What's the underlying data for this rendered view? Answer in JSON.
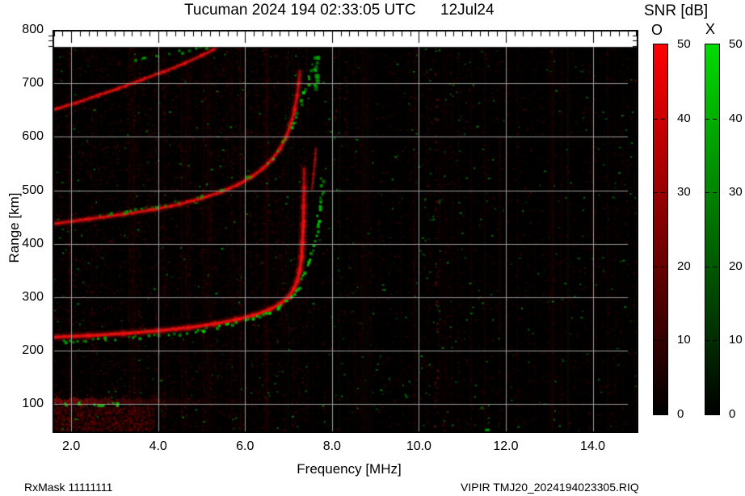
{
  "title": {
    "main": "Tucuman 2024 194 02:33:05 UTC",
    "date": "12Jul24"
  },
  "footer": {
    "left": "RxMask 11111111",
    "right": "VIPIR  TMJ20_2024194023305.RIQ"
  },
  "colorbar": {
    "title": "SNR [dB]",
    "o_label": "O",
    "x_label": "X",
    "min": 0,
    "max": 50,
    "ticks": [
      0,
      10,
      20,
      30,
      40,
      50
    ],
    "o_color_top": "#ff0000",
    "x_color_top": "#00dc00",
    "bottom_color": "#000000"
  },
  "chart_data": {
    "type": "heatmap",
    "title": "Tucuman 2024 194 02:33:05 UTC 12Jul24",
    "xlabel": "Frequency [MHz]",
    "ylabel": "Range [km]",
    "xlim": [
      1.57,
      15.05
    ],
    "ylim": [
      46,
      800
    ],
    "x_ticks": [
      2,
      4,
      6,
      8,
      10,
      12,
      14
    ],
    "x_tick_labels": [
      "2.0",
      "4.0",
      "6.0",
      "8.0",
      "10.0",
      "12.0",
      "14.0"
    ],
    "y_ticks": [
      100,
      200,
      300,
      400,
      500,
      600,
      700,
      800
    ],
    "grid": true,
    "grid_color": "#9b9b9b",
    "background_color": "#000000",
    "no_data_above_km": 768,
    "o_mode_color": "#e81010",
    "x_mode_color": "#00dd00",
    "traces": [
      {
        "name": "f2-trace-o",
        "mode": "O",
        "color": "#e81010",
        "style": "line",
        "width": 4,
        "alpha": 0.85,
        "fade_from_R": 430,
        "fade_span": 200,
        "points": [
          [
            1.57,
            225
          ],
          [
            2.4,
            228
          ],
          [
            3.2,
            232
          ],
          [
            4.0,
            237
          ],
          [
            4.7,
            243
          ],
          [
            5.3,
            250
          ],
          [
            5.8,
            258
          ],
          [
            6.2,
            266
          ],
          [
            6.55,
            276
          ],
          [
            6.8,
            287
          ],
          [
            7.0,
            300
          ],
          [
            7.12,
            314
          ],
          [
            7.2,
            330
          ],
          [
            7.26,
            350
          ],
          [
            7.3,
            374
          ],
          [
            7.32,
            402
          ],
          [
            7.34,
            435
          ],
          [
            7.35,
            470
          ],
          [
            7.36,
            505
          ],
          [
            7.36,
            540
          ]
        ]
      },
      {
        "name": "f2-trace-x",
        "mode": "X",
        "color": "#00dd00",
        "style": "blobs",
        "size": 3,
        "p": 0.6,
        "alpha": 0.9,
        "fade_from_R": 470,
        "fade_span": 120,
        "points": [
          [
            4.9,
            240
          ],
          [
            5.4,
            248
          ],
          [
            5.9,
            257
          ],
          [
            6.3,
            266
          ],
          [
            6.6,
            277
          ],
          [
            6.85,
            290
          ],
          [
            7.05,
            305
          ],
          [
            7.2,
            322
          ],
          [
            7.3,
            340
          ],
          [
            7.4,
            360
          ],
          [
            7.5,
            383
          ],
          [
            7.58,
            410
          ],
          [
            7.65,
            440
          ],
          [
            7.7,
            472
          ],
          [
            7.73,
            500
          ],
          [
            7.75,
            528
          ]
        ]
      },
      {
        "name": "f2-x-underside",
        "mode": "X",
        "color": "#00cc00",
        "style": "blobs",
        "size": 3,
        "p": 0.42,
        "alpha": 0.8,
        "points": [
          [
            1.8,
            219
          ],
          [
            2.2,
            221
          ],
          [
            2.6,
            223
          ],
          [
            3.0,
            225
          ],
          [
            3.4,
            227
          ],
          [
            3.8,
            229
          ],
          [
            4.2,
            232
          ],
          [
            4.6,
            236
          ],
          [
            5.0,
            240
          ]
        ]
      },
      {
        "name": "second-hop-o",
        "mode": "O",
        "color": "#d81010",
        "style": "line",
        "width": 3.5,
        "alpha": 0.8,
        "fade_from_R": 660,
        "fade_span": 140,
        "points": [
          [
            1.57,
            437
          ],
          [
            2.4,
            446
          ],
          [
            3.2,
            455
          ],
          [
            3.9,
            464
          ],
          [
            4.5,
            474
          ],
          [
            5.0,
            485
          ],
          [
            5.45,
            497
          ],
          [
            5.85,
            511
          ],
          [
            6.15,
            525
          ],
          [
            6.4,
            540
          ],
          [
            6.62,
            557
          ],
          [
            6.8,
            577
          ],
          [
            6.95,
            600
          ],
          [
            7.06,
            625
          ],
          [
            7.14,
            650
          ],
          [
            7.2,
            677
          ],
          [
            7.24,
            702
          ],
          [
            7.26,
            722
          ]
        ]
      },
      {
        "name": "second-hop-x",
        "mode": "X",
        "color": "#00d000",
        "style": "blobs",
        "size": 3,
        "p": 0.55,
        "alpha": 0.85,
        "fade_from_R": 720,
        "fade_span": 90,
        "points": [
          [
            6.45,
            545
          ],
          [
            6.7,
            570
          ],
          [
            6.9,
            595
          ],
          [
            7.07,
            622
          ],
          [
            7.2,
            650
          ],
          [
            7.32,
            678
          ],
          [
            7.42,
            703
          ],
          [
            7.5,
            727
          ],
          [
            7.56,
            748
          ]
        ]
      },
      {
        "name": "second-hop-x-top-specks",
        "mode": "X",
        "color": "#00bb00",
        "style": "blobs",
        "size": 3,
        "p": 0.3,
        "alpha": 0.7,
        "points": [
          [
            2.6,
            455
          ],
          [
            3.2,
            462
          ],
          [
            3.9,
            471
          ],
          [
            4.5,
            481
          ],
          [
            5.0,
            492
          ],
          [
            5.5,
            505
          ],
          [
            5.9,
            519
          ],
          [
            6.2,
            533
          ]
        ]
      },
      {
        "name": "second-hop-x-spur",
        "mode": "O",
        "color": "#b80f0f",
        "style": "line",
        "width": 2.2,
        "alpha": 0.55,
        "points": [
          [
            7.54,
            502
          ],
          [
            7.58,
            530
          ],
          [
            7.61,
            556
          ],
          [
            7.63,
            578
          ]
        ]
      },
      {
        "name": "oblique-trace-o",
        "mode": "O",
        "color": "#dd1010",
        "style": "line",
        "width": 3,
        "alpha": 0.7,
        "points": [
          [
            1.57,
            650
          ],
          [
            2.1,
            663
          ],
          [
            2.6,
            677
          ],
          [
            3.1,
            691
          ],
          [
            3.6,
            706
          ],
          [
            4.1,
            721
          ],
          [
            4.6,
            737
          ],
          [
            5.0,
            752
          ],
          [
            5.3,
            764
          ]
        ]
      },
      {
        "name": "oblique-trace-x-specks",
        "mode": "X",
        "color": "#00c000",
        "style": "blobs",
        "size": 3,
        "p": 0.5,
        "alpha": 0.75,
        "points": [
          [
            3.4,
            742
          ],
          [
            3.7,
            748
          ],
          [
            4.0,
            753
          ],
          [
            4.3,
            758
          ],
          [
            4.6,
            763
          ],
          [
            4.9,
            768
          ],
          [
            5.15,
            772
          ],
          [
            5.35,
            775
          ]
        ]
      },
      {
        "name": "spread-f-green-column",
        "mode": "X",
        "color": "#00c000",
        "style": "blobs",
        "size": 4,
        "p": 0.7,
        "alpha": 0.8,
        "points": [
          [
            7.58,
            692
          ],
          [
            7.6,
            706
          ],
          [
            7.62,
            720
          ],
          [
            7.59,
            734
          ],
          [
            7.61,
            748
          ],
          [
            7.6,
            760
          ]
        ]
      },
      {
        "name": "faint-red-column-1",
        "mode": "O",
        "color": "#701010",
        "style": "blobs",
        "size": 2,
        "p": 0.35,
        "alpha": 0.5,
        "points": [
          [
            8.05,
            560
          ],
          [
            8.06,
            610
          ],
          [
            8.05,
            660
          ],
          [
            8.06,
            710
          ],
          [
            8.05,
            755
          ]
        ]
      },
      {
        "name": "faint-red-column-2",
        "mode": "O",
        "color": "#600d0d",
        "style": "blobs",
        "size": 2,
        "p": 0.3,
        "alpha": 0.45,
        "points": [
          [
            8.3,
            580
          ],
          [
            8.31,
            630
          ],
          [
            8.3,
            690
          ],
          [
            8.31,
            745
          ]
        ]
      },
      {
        "name": "rfi-red-column",
        "mode": "O",
        "color": "#8a1010",
        "style": "blobs",
        "size": 2,
        "p": 0.3,
        "alpha": 0.55,
        "points": [
          [
            10.38,
            52
          ],
          [
            10.39,
            200
          ],
          [
            10.38,
            400
          ],
          [
            10.39,
            600
          ],
          [
            10.38,
            770
          ]
        ]
      }
    ],
    "e_region": {
      "range_km": 104,
      "f_start": 1.57,
      "f_end": 5.9,
      "alpha": 0.55,
      "green_f_end": 3.2,
      "green_count": 16
    },
    "marks": [
      {
        "f": 10.35,
        "R": 60,
        "w": 3,
        "h": 2,
        "color": "#aa1818",
        "alpha": 0.7
      },
      {
        "f": 11.52,
        "R": 54,
        "w": 6,
        "h": 3,
        "color": "#00b400",
        "alpha": 0.85
      },
      {
        "f": 11.42,
        "R": 95,
        "w": 3,
        "h": 3,
        "color": "#00a000",
        "alpha": 0.6
      },
      {
        "f": 11.58,
        "R": 75,
        "w": 3,
        "h": 2,
        "color": "#009600",
        "alpha": 0.55
      },
      {
        "f": 10.12,
        "R": 485,
        "w": 3,
        "h": 3,
        "color": "#00a000",
        "alpha": 0.5
      }
    ],
    "noise": {
      "seed": 2024194,
      "speckles": 26000,
      "columns": 130,
      "green_specks": 900,
      "bottom_left_fuzz": 1400,
      "green_boost_fmin": 9.9,
      "green_boost_fmax": 11.4
    }
  }
}
